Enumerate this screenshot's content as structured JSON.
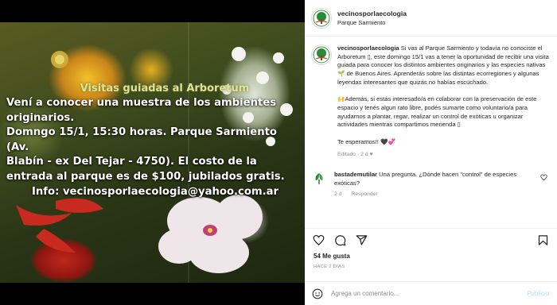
{
  "post": {
    "image_title": "Visitas guiadas al Arboretum",
    "image_lines": [
      "Vení a conocer una muestra de los ambientes",
      "originarios.",
      "Domngo 15/1, 15:30 horas. Parque Sarmiento (Av.",
      "Blabín - ex Del Tejar - 4750). El costo de la",
      "entrada al parque es de $100, jubilados gratis.",
      "Info: vecinosporlaecologia@yahoo.com.ar"
    ]
  },
  "header": {
    "username": "vecinosporlaecologia",
    "location": "Parque Sarmiento"
  },
  "caption": {
    "username": "vecinosporlaecologia",
    "paragraph1": "Si vas al Parque Sarmiento y todavía no conociste el Arboretum ▯, este domingo 15/1 vas a tener la oportunidad de recibir una visita guiada para conocer los distintos ambientes originarios y las especies nativas 🌱 de Buenos Aires. Aprenderás sobre las distintas ecorregiones y algunas leyendas interesantes que quizás no habías escuchado.",
    "paragraph2": "🙌Además, si estás interesado/a en colaborar con la preservación de este espacio y tenés algun rato libre, podés sumarte como voluntario/a para ayudarnos a plantar, regar, realizar un control de exóticas u organizar actividades mientras compartimos merienda ▯",
    "paragraph3": "Te esperamos!! 🖤💞",
    "edited": "Editado · 2 d",
    "heart": "♥"
  },
  "comment": {
    "username": "bastademutilar",
    "text": "Una pregunta. ¿Dónde hacen \"control\" de especies exóticas?",
    "time": "2 d",
    "reply_label": "Responder",
    "like_icon": "heart-outline-icon"
  },
  "stats": {
    "likes": "54 Me gusta",
    "posted": "HACE 2 DÍAS"
  },
  "composer": {
    "placeholder": "Agrega un comentario...",
    "publish_label": "Publicar"
  },
  "colors": {
    "accent_link": "#b2dffc",
    "muted": "#8e8e8e",
    "text": "#262626",
    "logo_green": "#2a8a3a"
  },
  "icons": [
    "heart-icon",
    "comment-icon",
    "share-icon",
    "bookmark-icon",
    "emoji-icon"
  ]
}
